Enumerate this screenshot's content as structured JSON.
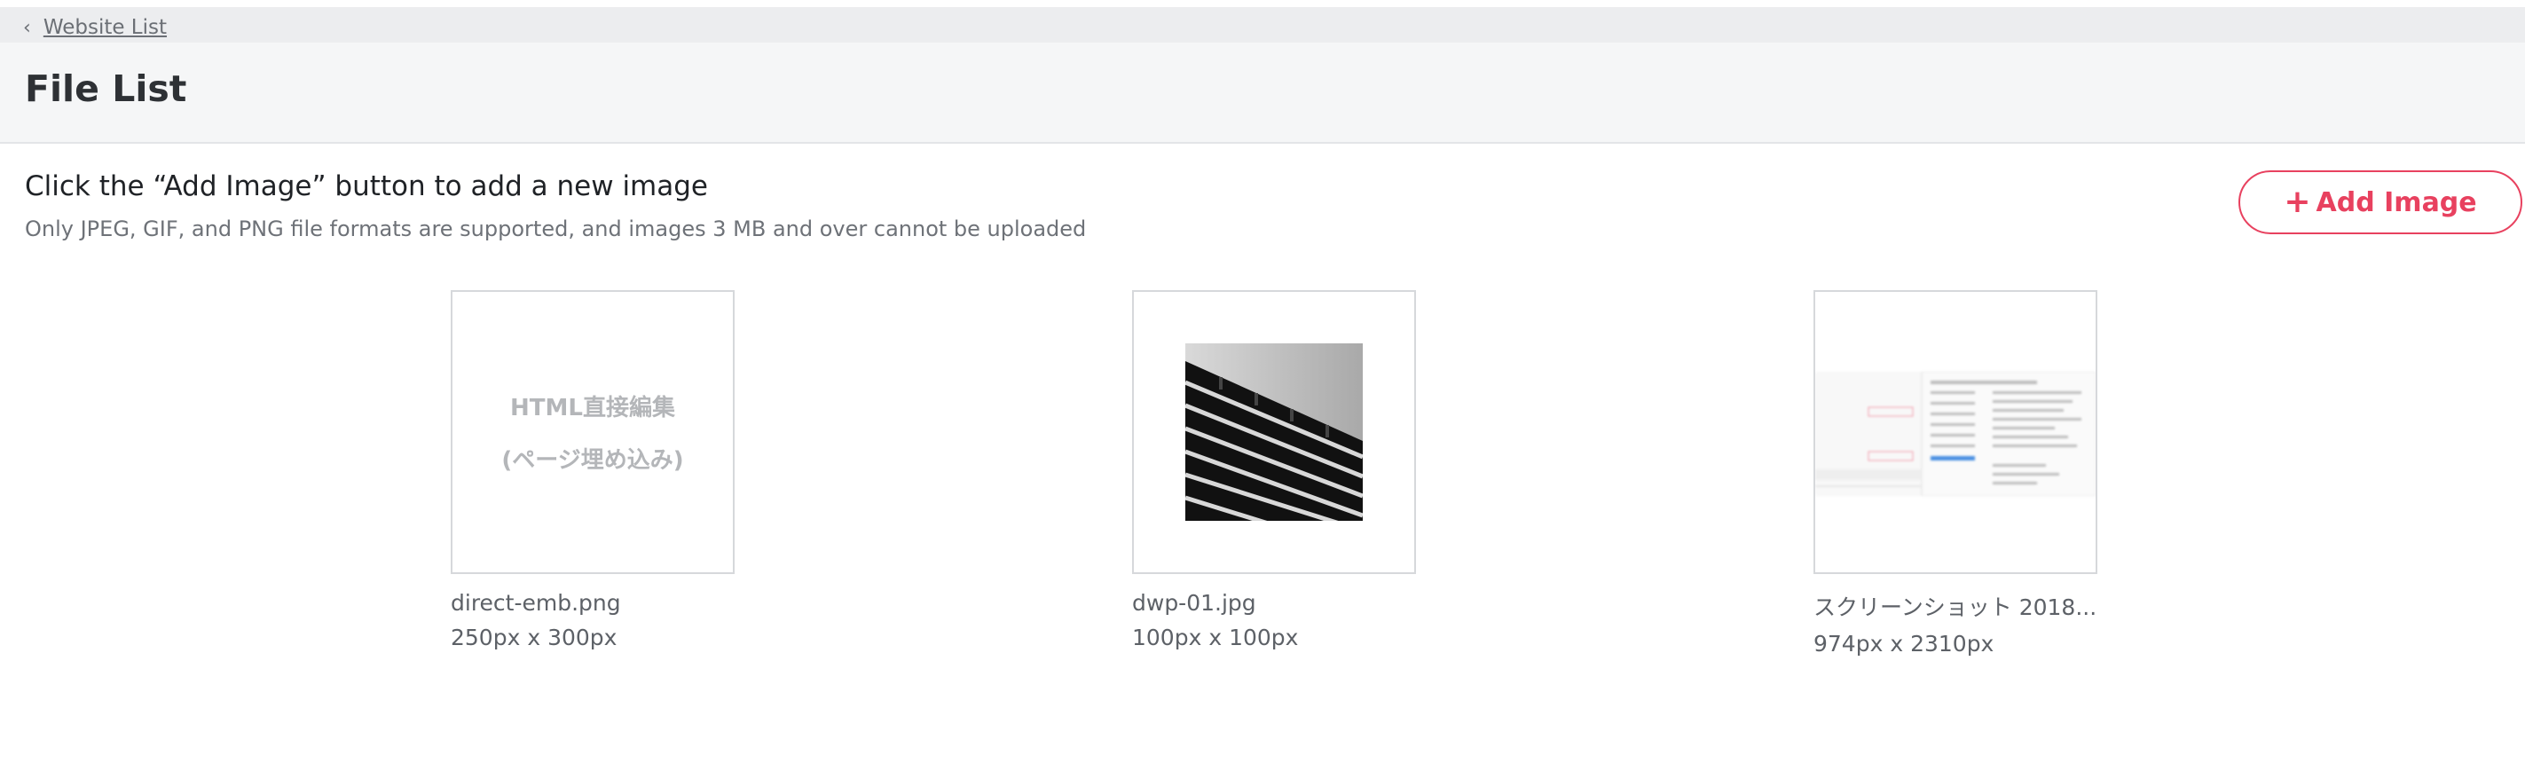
{
  "breadcrumb": {
    "back_label": "Website List"
  },
  "page": {
    "title": "File List"
  },
  "intro": {
    "title": "Click the “Add Image” button to add a new image",
    "subtitle": "Only JPEG, GIF, and PNG file formats are supported, and images 3 MB and over cannot be uploaded"
  },
  "add_button": {
    "label": "Add Image"
  },
  "files": [
    {
      "name": "direct-emb.png",
      "size": "250px x 300px",
      "thumb_text": [
        "HTML直接編集",
        "(ページ埋め込み)"
      ]
    },
    {
      "name": "dwp-01.jpg",
      "size": "100px x 100px"
    },
    {
      "name": "スクリーンショット 2018...",
      "size": "974px x 2310px"
    }
  ],
  "colors": {
    "accent": "#e8415f",
    "title_bg": "#f5f6f7",
    "crumb_bg": "#ecedef"
  }
}
